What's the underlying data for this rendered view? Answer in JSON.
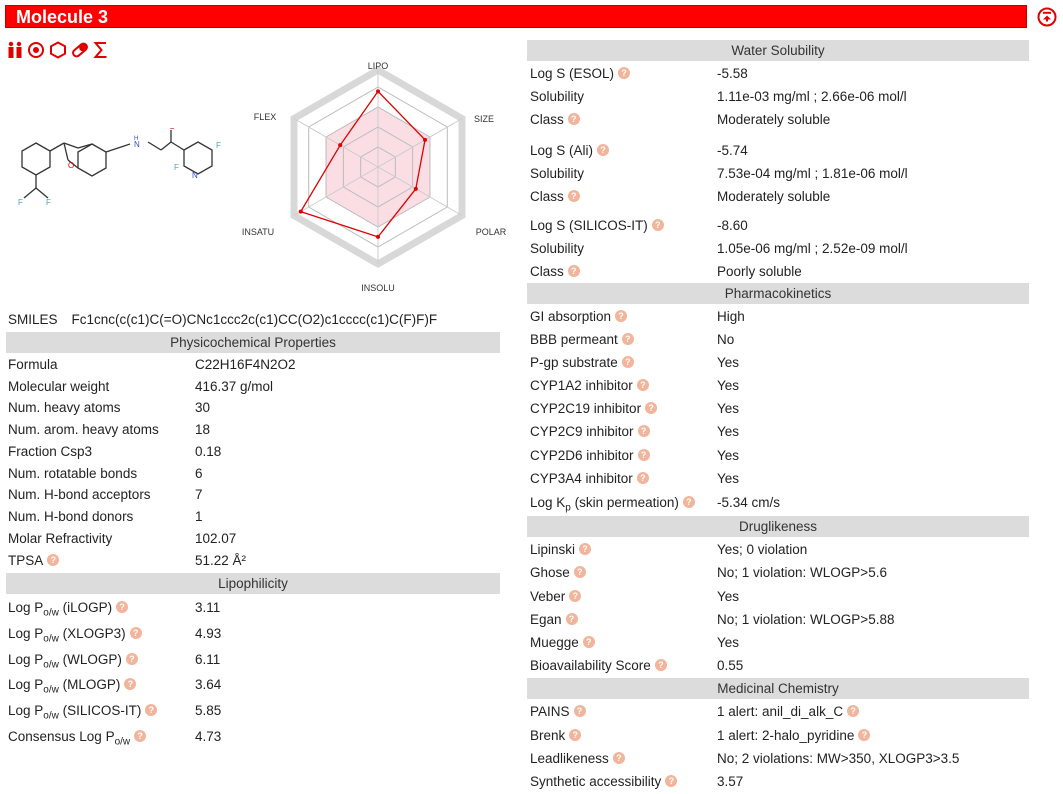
{
  "header": {
    "title": "Molecule 3"
  },
  "radar": {
    "axes": [
      "LIPO",
      "SIZE",
      "POLAR",
      "INSOLU",
      "INSATU",
      "FLEX"
    ],
    "accent": "#e00000",
    "fill": "#f7c8d2"
  },
  "smiles": {
    "label": "SMILES",
    "value": "Fc1cnc(c(c1)C(=O)CNc1ccc2c(c1)CC(O2)c1cccc(c1)C(F)F)F"
  },
  "physchem": {
    "title": "Physicochemical Properties",
    "rows": [
      {
        "k": "Formula",
        "v": "C22H16F4N2O2"
      },
      {
        "k": "Molecular weight",
        "v": "416.37 g/mol"
      },
      {
        "k": "Num. heavy atoms",
        "v": "30"
      },
      {
        "k": "Num. arom. heavy atoms",
        "v": "18"
      },
      {
        "k": "Fraction Csp3",
        "v": "0.18"
      },
      {
        "k": "Num. rotatable bonds",
        "v": "6"
      },
      {
        "k": "Num. H-bond acceptors",
        "v": "7"
      },
      {
        "k": "Num. H-bond donors",
        "v": "1"
      },
      {
        "k": "Molar Refractivity",
        "v": "102.07"
      },
      {
        "k": "TPSA",
        "v": "51.22 Å²"
      }
    ]
  },
  "lipo": {
    "title": "Lipophilicity",
    "prefix": "Log P",
    "sub": "o/w",
    "rows": [
      {
        "k": " (iLOGP)",
        "v": "3.11"
      },
      {
        "k": " (XLOGP3)",
        "v": "4.93"
      },
      {
        "k": " (WLOGP)",
        "v": "6.11"
      },
      {
        "k": " (MLOGP)",
        "v": "3.64"
      },
      {
        "k": " (SILICOS-IT)",
        "v": "5.85"
      }
    ],
    "consensus_label": "Consensus Log P",
    "consensus_value": "4.73"
  },
  "water": {
    "title": "Water Solubility",
    "log_prefix": "Log S",
    "groups": [
      {
        "method": " (ESOL)",
        "logs": "-5.58",
        "sol_label": "Solubility",
        "sol": "1.11e-03 mg/ml ; 2.66e-06 mol/l",
        "class_label": "Class",
        "class": "Moderately soluble"
      },
      {
        "method": " (Ali)",
        "logs": "-5.74",
        "sol_label": "Solubility",
        "sol": "7.53e-04 mg/ml ; 1.81e-06 mol/l",
        "class_label": "Class",
        "class": "Moderately soluble"
      },
      {
        "method": " (SILICOS-IT)",
        "logs": "-8.60",
        "sol_label": "Solubility",
        "sol": "1.05e-06 mg/ml ; 2.52e-09 mol/l",
        "class_label": "Class",
        "class": "Poorly soluble"
      }
    ]
  },
  "pk": {
    "title": "Pharmacokinetics",
    "rows": [
      {
        "k": "GI absorption",
        "v": "High"
      },
      {
        "k": "BBB permeant",
        "v": "No"
      },
      {
        "k": "P-gp substrate",
        "v": "Yes"
      },
      {
        "k": "CYP1A2 inhibitor",
        "v": "Yes"
      },
      {
        "k": "CYP2C19 inhibitor",
        "v": "Yes"
      },
      {
        "k": "CYP2C9 inhibitor",
        "v": "Yes"
      },
      {
        "k": "CYP2D6 inhibitor",
        "v": "Yes"
      },
      {
        "k": "CYP3A4 inhibitor",
        "v": "Yes"
      }
    ],
    "kp_label": "Log K",
    "kp_sub": "p",
    "kp_suffix": " (skin permeation)",
    "kp_value": "-5.34 cm/s"
  },
  "drug": {
    "title": "Druglikeness",
    "rows": [
      {
        "k": "Lipinski",
        "v": "Yes; 0 violation"
      },
      {
        "k": "Ghose",
        "v": "No; 1 violation: WLOGP>5.6"
      },
      {
        "k": "Veber",
        "v": "Yes"
      },
      {
        "k": "Egan",
        "v": "No; 1 violation: WLOGP>5.88"
      },
      {
        "k": "Muegge",
        "v": "Yes"
      },
      {
        "k": "Bioavailability Score",
        "v": "0.55"
      }
    ]
  },
  "medchem": {
    "title": "Medicinal Chemistry",
    "rows": [
      {
        "k": "PAINS",
        "v": "1 alert: anil_di_alk_C"
      },
      {
        "k": "Brenk",
        "v": "1 alert: 2-halo_pyridine"
      },
      {
        "k": "Leadlikeness",
        "v": "No; 2 violations: MW>350, XLOGP3>3.5"
      },
      {
        "k": "Synthetic accessibility",
        "v": "3.57"
      }
    ]
  }
}
